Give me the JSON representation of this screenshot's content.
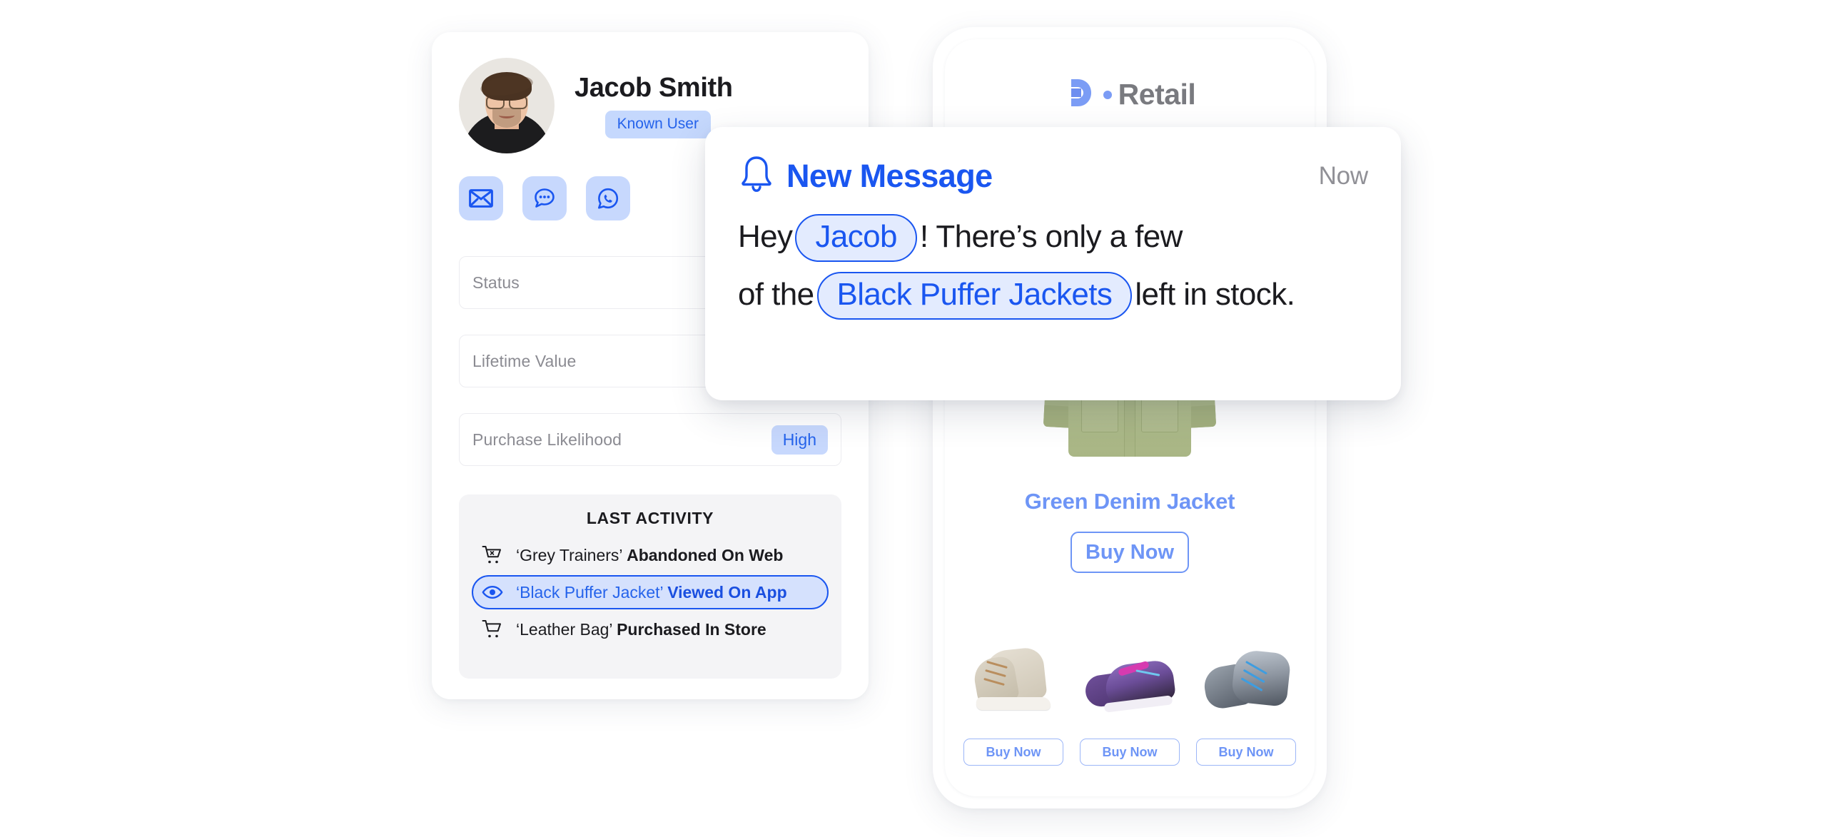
{
  "profile": {
    "name": "Jacob Smith",
    "badge": "Known User",
    "avatar_alt": "user-photo",
    "contacts": [
      {
        "name": "email-icon",
        "label": "Email"
      },
      {
        "name": "sms-chat-icon",
        "label": "SMS"
      },
      {
        "name": "whatsapp-icon",
        "label": "WhatsApp"
      }
    ],
    "fields": [
      {
        "label": "Status",
        "value": ""
      },
      {
        "label": "Lifetime Value",
        "value": ""
      },
      {
        "label": "Purchase Likelihood",
        "value": "High"
      }
    ],
    "last_activity": {
      "title": "LAST ACTIVITY",
      "items": [
        {
          "icon": "cart-x-icon",
          "product": "‘Grey Trainers’",
          "action": "Abandoned On Web",
          "highlighted": false
        },
        {
          "icon": "eye-icon",
          "product": "‘Black Puffer Jacket’",
          "action": "Viewed On App",
          "highlighted": true
        },
        {
          "icon": "cart-icon",
          "product": "‘Leather Bag’",
          "action": "Purchased In Store",
          "highlighted": false
        }
      ]
    }
  },
  "phone": {
    "brand": {
      "mark": "d-logo-icon",
      "dot": "bullet-dot",
      "wordmark": "Retail"
    },
    "featured_product": {
      "image": "green-denim-jacket-image",
      "name": "Green Denim Jacket",
      "buy_label": "Buy Now"
    },
    "recommended": [
      {
        "image": "beige-high-top-sneaker-image",
        "buy_label": "Buy Now"
      },
      {
        "image": "purple-running-shoe-image",
        "buy_label": "Buy Now"
      },
      {
        "image": "grey-blue-trainer-image",
        "buy_label": "Buy Now"
      }
    ]
  },
  "notification": {
    "icon": "bell-icon",
    "title": "New Message",
    "time": "Now",
    "line1_pre": "Hey",
    "token1": "Jacob",
    "line1_post": "! There’s only a few",
    "line2_pre": "of the",
    "token2": "Black Puffer Jackets",
    "line2_post": "left in stock."
  },
  "colors": {
    "accent_blue": "#1a56f0",
    "soft_blue": "#6e95f6",
    "badge_bg": "#c7d8fd",
    "token_bg": "#e3ebfe",
    "panel_bg": "#f4f4f6",
    "text_dark": "#1b1b1f",
    "text_muted": "#8b8b92",
    "jacket_green": "#b0bd8c"
  }
}
